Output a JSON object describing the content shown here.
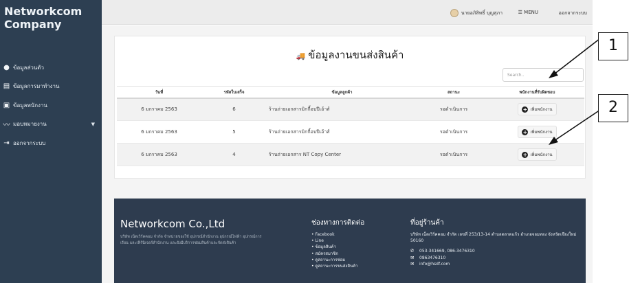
{
  "sidebar": {
    "brand_line1": "Networkcom",
    "brand_line2": "Company",
    "items": [
      {
        "icon": "user-circle-icon",
        "glyph": "●",
        "label": "ข้อมูลส่วนตัว"
      },
      {
        "icon": "document-icon",
        "glyph": "▤",
        "label": "ข้อมูลการมาทำงาน"
      },
      {
        "icon": "id-card-icon",
        "glyph": "▣",
        "label": "ข้อมูลพนักงาน"
      },
      {
        "icon": "chart-line-icon",
        "glyph": "〰",
        "label": "มอบหมายงาน"
      },
      {
        "icon": "sign-out-icon",
        "glyph": "⇥",
        "label": "ออกจากระบบ"
      }
    ]
  },
  "topbar": {
    "user_name": "นายอภิสิทธิ์ บุญสุภา",
    "menu_label": "MENU",
    "logout_label": "ออกจากระบบ"
  },
  "page": {
    "title": "ข้อมูลงานขนส่งสินค้า",
    "search_placeholder": "Search.."
  },
  "table": {
    "headers": [
      "วันที่",
      "รหัสใบเสร็จ",
      "ข้อมูลลูกค้า",
      "สถานะ",
      "พนักงานที่รับผิดชอบ"
    ],
    "rows": [
      {
        "date": "6 มกราคม 2563",
        "receipt": "6",
        "customer": "ร้านถ่ายเอกสารมิกกี้อบปีเอ้าส์",
        "status": "รอดำเนินการ",
        "action": "เพิ่มพนักงาน"
      },
      {
        "date": "6 มกราคม 2563",
        "receipt": "5",
        "customer": "ร้านถ่ายเอกสารมิกกี้อบปีเอ้าส์",
        "status": "รอดำเนินการ",
        "action": "เพิ่มพนักงาน"
      },
      {
        "date": "6 มกราคม 2563",
        "receipt": "4",
        "customer": "ร้านถ่ายเอกสาร NT Copy Center",
        "status": "รอดำเนินการ",
        "action": "เพิ่มพนักงาน"
      }
    ]
  },
  "footer": {
    "company": "Networkcom Co.,Ltd",
    "description": "บริษัท เน็ตเวิร์คคอม จำกัด จำหน่ายของใช้ อุปกรณ์สำนักงาน อุปกรณ์ไฟฟ้า อุปกรณ์การเรียน และเฟิร์นิเจอร์สำนักงาน และยังมีบริการซ่อมสินค้าและจัดส่งสินค้า",
    "contact_heading": "ช่องทางการติดต่อ",
    "links": [
      "Facebook",
      "Line",
      "ข้อมูลสินค้า",
      "สมัครสมาชิก",
      "ดูสถานะการซ่อม",
      "ดูสถานะการขนส่งสินค้า"
    ],
    "address_heading": "ที่อยู่ร้านค้า",
    "address": "บริษัท เน็ตเวิร์คคอม จำกัด เลขที่ 253/13-14 ตำบลตลาดแก้ว อำเภอจอมทอง จังหวัดเชียงใหม่ 50160",
    "phone": "053-341669, 086-3476310",
    "mobile": "0863476310",
    "email": "info@hsdf.com"
  },
  "callouts": [
    "1",
    "2"
  ]
}
